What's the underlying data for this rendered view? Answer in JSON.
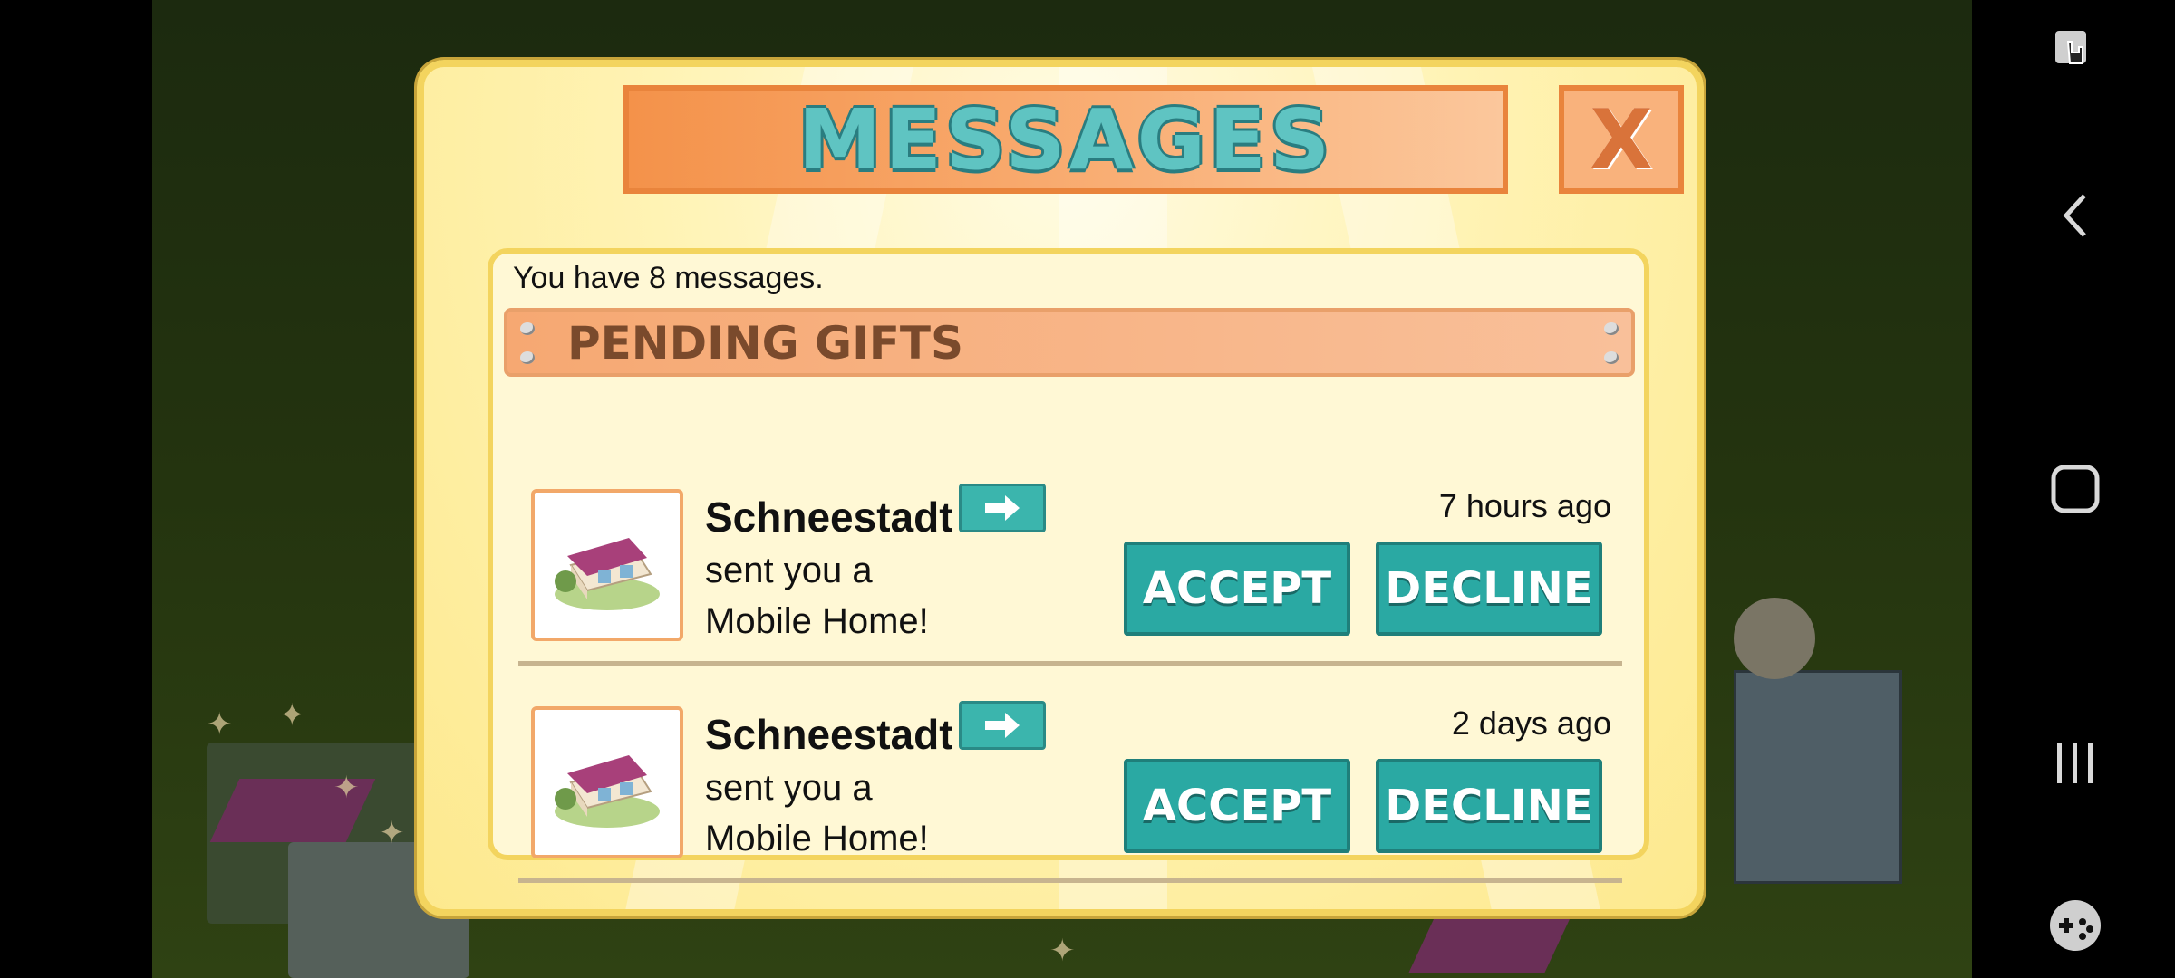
{
  "dialog": {
    "title": "MESSAGES",
    "close_label": "X",
    "message_count_text": "You have 8 messages.",
    "section_label": "PENDING GIFTS",
    "gifts": [
      {
        "sender": "Schneestadt",
        "message_line1": "sent you a",
        "message_line2": "Mobile Home!",
        "time": "7 hours ago",
        "accept_label": "ACCEPT",
        "decline_label": "DECLINE"
      },
      {
        "sender": "Schneestadt",
        "message_line1": "sent you a",
        "message_line2": "Mobile Home!",
        "time": "2 days ago",
        "accept_label": "ACCEPT",
        "decline_label": "DECLINE"
      }
    ]
  },
  "colors": {
    "teal_button": "#2aa9a3",
    "orange_banner": "#f4924a",
    "dialog_yellow": "#fff3b4"
  },
  "system_nav": {
    "icons": [
      "screen-pointer-icon",
      "back-icon",
      "home-icon",
      "recents-icon",
      "game-launcher-icon"
    ]
  }
}
